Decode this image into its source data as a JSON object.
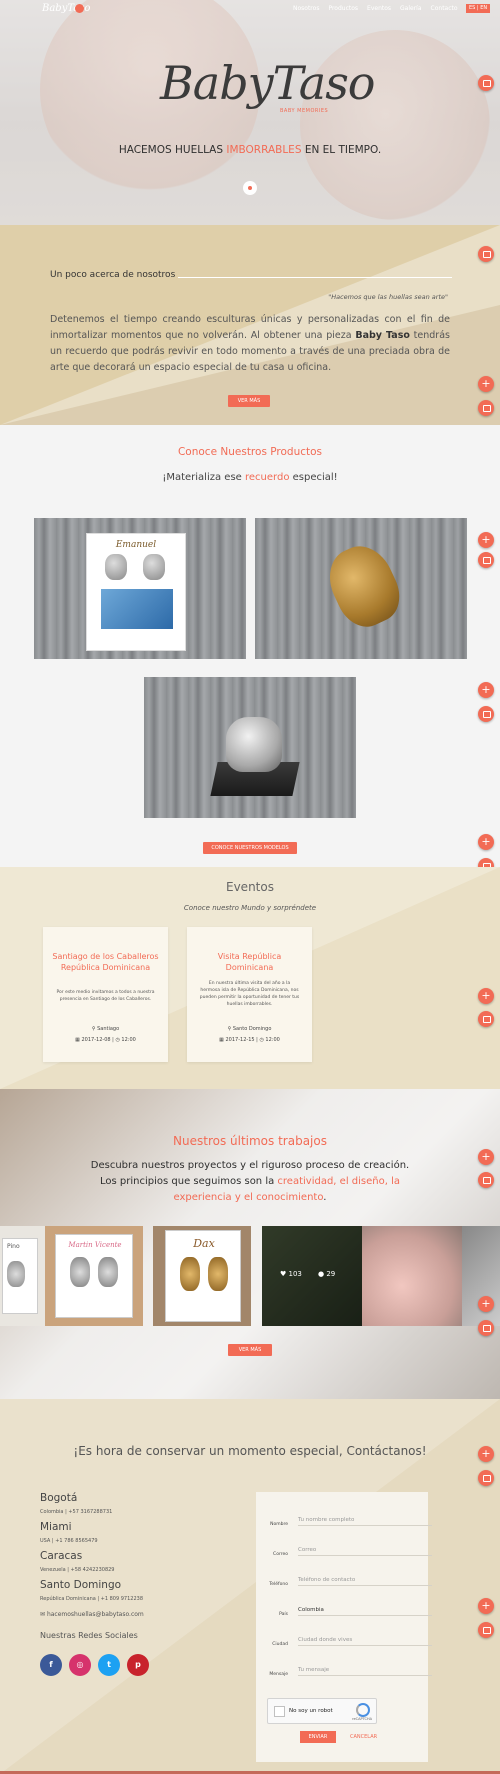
{
  "nav": {
    "logo": "BabyTaso",
    "items": [
      "Nosotros",
      "Productos",
      "Eventos",
      "Galería",
      "Contacto"
    ],
    "lang": "ES | EN"
  },
  "hero": {
    "brand": "BabyTaso",
    "brand_sub": "BABY MEMORIES",
    "tagline_before": "HACEMOS HUELLAS ",
    "tagline_highlight": "IMBORRABLES",
    "tagline_after": " EN EL TIEMPO."
  },
  "about": {
    "title": "Un poco acerca de nosotros",
    "quote": "\"Hacemos que las huellas sean arte\"",
    "text_1": "Detenemos el tiempo creando esculturas únicas y personalizadas con el fin de inmortalizar momentos que no volverán. Al obtener una pieza ",
    "text_brand": "Baby Taso",
    "text_2": " tendrás un recuerdo que podrás revivir en todo momento a través de una preciada obra de arte que decorará un espacio especial de tu casa u oficina.",
    "button": "VER MÁS"
  },
  "products": {
    "title": "Conoce Nuestros Productos",
    "subtitle_before": "¡Materializa ese ",
    "subtitle_highlight": "recuerdo",
    "subtitle_after": " especial!",
    "frame_name": "Emanuel",
    "button": "CONOCE NUESTROS MODELOS"
  },
  "events": {
    "title": "Eventos",
    "subtitle": "Conoce nuestro Mundo y sorpréndete",
    "cards": [
      {
        "title": "Santiago de los Caballeros República Dominicana",
        "desc": "Por este medio invitamos a todos a nuestra presencia en Santiago de los Caballeros.",
        "location": "Santiago",
        "date": "2017-12-08",
        "time": "12:00"
      },
      {
        "title": "Visita República Dominicana",
        "desc": "En nuestra última visita del año a la hermosa isla de República Dominicana, nos pueden permitir la oportunidad de tener tus huellas imborrables.",
        "location": "Santo Domingo",
        "date": "2017-12-15",
        "time": "12:00"
      }
    ]
  },
  "works": {
    "title": "Nuestros últimos trabajos",
    "line1": "Descubra nuestros proyectos y el riguroso proceso de creación.",
    "line2_before": "Los principios que seguimos son la ",
    "line2_highlight_1": "creatividad, el diseño, la experiencia y el conocimiento",
    "line2_after": ".",
    "tiles": [
      "Pino",
      "Martin Vicente",
      "Dax"
    ],
    "likes": "103",
    "comments": "29",
    "button": "VER MÁS"
  },
  "contact": {
    "title": "¡Es hora de conservar un momento especial, Contáctanos!",
    "cities": [
      {
        "name": "Bogotá",
        "info": "Colombia | +57 3167288731"
      },
      {
        "name": "Miami",
        "info": "USA | +1 786 8565479"
      },
      {
        "name": "Caracas",
        "info": "Venezuela | +58 4242230829"
      },
      {
        "name": "Santo Domingo",
        "info": "República Dominicana | +1 809 9712238"
      }
    ],
    "email": "hacemoshuellas@babytaso.com",
    "social_title": "Nuestras Redes Sociales",
    "form": {
      "labels": [
        "Nombre",
        "Correo",
        "Teléfono",
        "País",
        "Ciudad",
        "Mensaje"
      ],
      "placeholders": [
        "Tu nombre completo",
        "Correo",
        "Teléfono de contacto",
        "Colombia",
        "Ciudad donde vives",
        "Tu mensaje"
      ],
      "captcha": "No soy un robot",
      "captcha_brand": "reCAPTCHA",
      "send": "ENVIAR",
      "cancel": "CANCELAR"
    }
  },
  "colors": {
    "accent": "#f26b55",
    "facebook": "#3b5998",
    "instagram": "#d6336c",
    "twitter": "#1da1f2",
    "pinterest": "#c8232c"
  }
}
